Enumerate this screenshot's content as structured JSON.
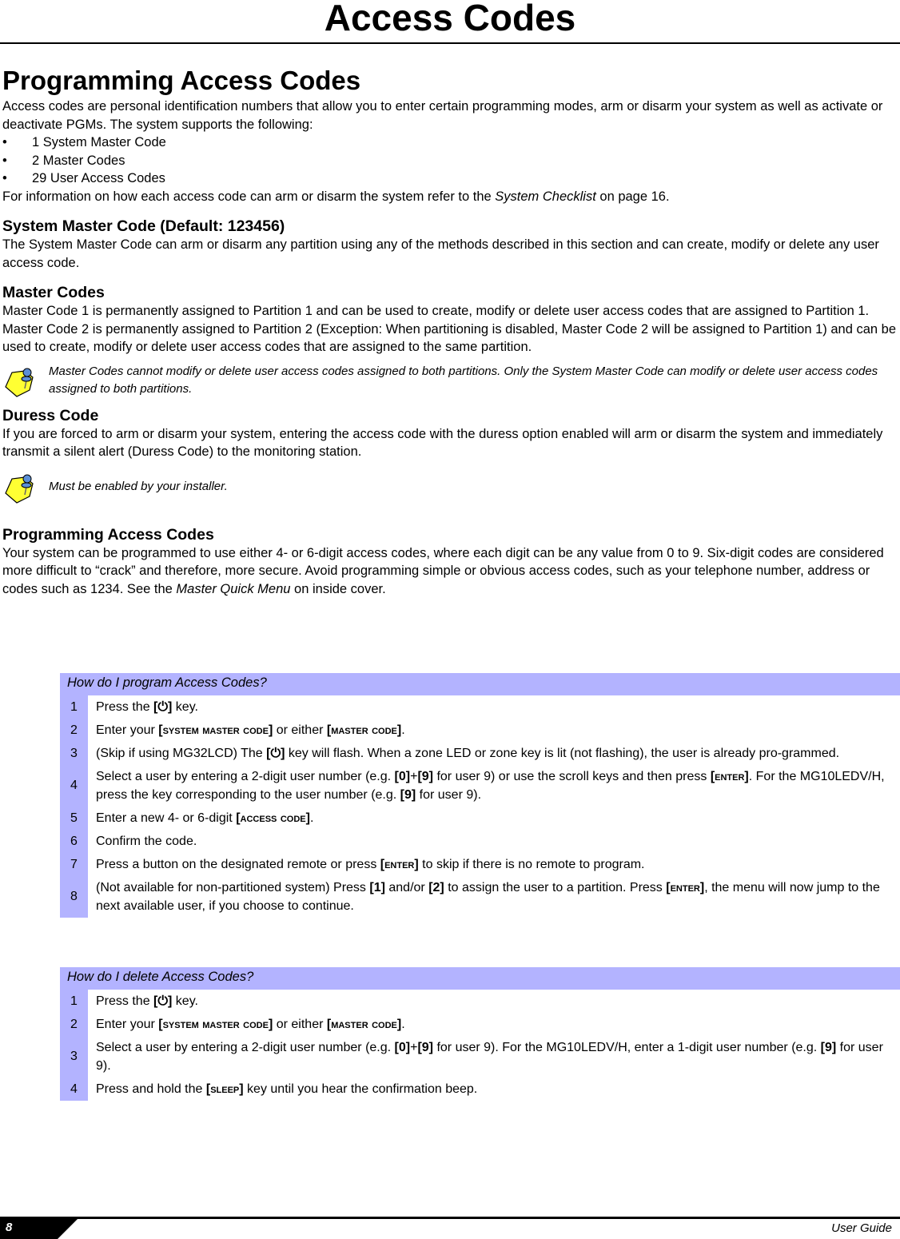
{
  "page": {
    "title": "Access Codes"
  },
  "intro": {
    "heading": "Programming Access Codes",
    "para": "Access codes are personal identification numbers that allow you to enter certain programming modes, arm or disarm your system as well as activate or deactivate PGMs. The system supports the following:",
    "bullets": [
      "1 System Master Code",
      "2 Master Codes",
      "29 User Access Codes"
    ],
    "bullet_glyph": "•",
    "ref_pre": "For information on how each access code can arm or disarm the system refer to the ",
    "ref_link": "System Checklist",
    "ref_post": " on page 16."
  },
  "system_master": {
    "heading": "System Master Code (Default: 123456)",
    "para": "The System Master Code can arm or disarm any partition using any of the methods described in this section and can create, modify or delete any user access code."
  },
  "master_codes": {
    "heading": "Master Codes",
    "para1": "Master Code 1 is permanently assigned to Partition 1 and can be used to create, modify or delete user access codes that are assigned to Partition 1.",
    "para2": "Master Code 2 is permanently assigned to Partition 2 (Exception: When partitioning is disabled, Master Code 2 will be assigned to Partition 1) and can be used to create, modify or delete user access codes that are assigned to the same partition.",
    "note": "Master Codes cannot modify or delete user access codes assigned to both partitions. Only the System Master Code can modify or delete user access codes assigned to both partitions.",
    "note_icon": "note-pin-icon"
  },
  "duress": {
    "heading": "Duress Code",
    "para": "If you are forced to arm or disarm your system, entering the access code with the duress option enabled will arm or disarm the system and immediately transmit a silent alert (Duress Code) to the monitoring station.",
    "note": "Must be enabled by your installer.",
    "note_icon": "note-pin-icon"
  },
  "programming": {
    "heading": "Programming Access Codes",
    "para_pre": "Your system can be programmed to use either 4- or 6-digit access codes, where each digit can be any value from 0 to 9. Six-digit codes are considered more difficult to “crack” and therefore, more secure. Avoid programming simple or obvious access codes, such as your telephone number, address or codes such as 1234. See the ",
    "para_link": "Master Quick Menu",
    "para_post": " on inside cover."
  },
  "program_steps": {
    "header": "How do I program Access Codes?",
    "steps": [
      {
        "num": "1",
        "parts": [
          "Press the ",
          "[",
          "⏻",
          "]",
          " key."
        ]
      },
      {
        "num": "2",
        "parts": [
          "Enter your ",
          "[SYSTEM MASTER CODE]",
          " or either ",
          "[MASTER CODE]",
          "."
        ]
      },
      {
        "num": "3",
        "parts": [
          "(Skip if using MG32LCD) The ",
          "[⏻]",
          " key will flash. When a zone LED or zone key is lit (not flashing), the user is already pro-grammed."
        ]
      },
      {
        "num": "4",
        "parts": [
          "Select a user by entering a 2-digit user number (e.g. ",
          "[0]",
          "+",
          "[9]",
          " for user 9) or use the scroll keys and then press ",
          "[ENTER]",
          ". For the MG10LEDV/H, press the key corresponding to the user number (e.g. ",
          "[9]",
          " for user 9)."
        ]
      },
      {
        "num": "5",
        "parts": [
          "Enter a new 4- or 6-digit ",
          "[ACCESS CODE]",
          "."
        ]
      },
      {
        "num": "6",
        "parts": [
          "Confirm the code."
        ]
      },
      {
        "num": "7",
        "parts": [
          "Press a button on the designated remote or press ",
          "[ENTER]",
          " to skip if there is no remote to program."
        ]
      },
      {
        "num": "8",
        "parts": [
          "(Not available for non-partitioned system) Press ",
          "[1]",
          " and/or ",
          "[2]",
          " to assign the user to a partition. Press ",
          "[ENTER]",
          ", the menu will now jump to the next available user, if you choose to continue."
        ]
      }
    ]
  },
  "delete_steps": {
    "header": "How do I delete Access Codes?",
    "steps": [
      {
        "num": "1",
        "parts": [
          "Press the ",
          "[⏻]",
          " key."
        ]
      },
      {
        "num": "2",
        "parts": [
          "Enter your ",
          "[SYSTEM MASTER CODE]",
          " or either ",
          "[MASTER CODE]",
          "."
        ]
      },
      {
        "num": "3",
        "parts": [
          "Select a user by entering a 2-digit user number (e.g. ",
          "[0]",
          "+",
          "[9]",
          " for user 9). For the MG10LEDV/H, enter a 1-digit user number (e.g. ",
          "[9]",
          " for user 9)."
        ]
      },
      {
        "num": "4",
        "parts": [
          "Press and hold the ",
          "[SLEEP]",
          " key until you hear the confirmation beep."
        ]
      }
    ]
  },
  "footer": {
    "page_number": "8",
    "guide_label": "User Guide"
  },
  "colors": {
    "step_band": "#b3b3ff",
    "note_icon_fill": "#ffff33",
    "pin": "#5b8fd6"
  }
}
